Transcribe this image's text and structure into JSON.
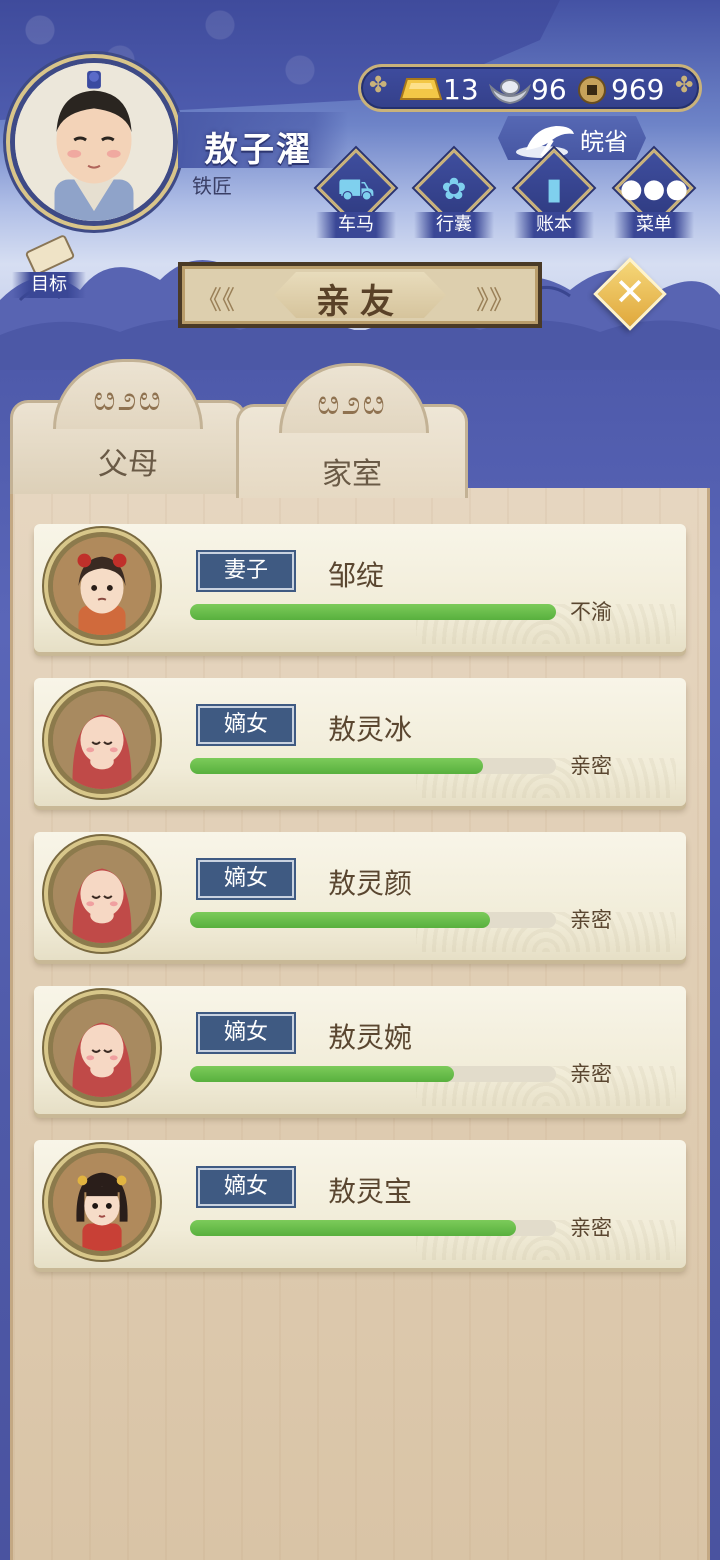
{
  "player": {
    "name": "敖子濯",
    "occupation": "铁匠"
  },
  "currency": {
    "gold": "13",
    "silver": "96",
    "coins": "969"
  },
  "region": {
    "label": "皖省"
  },
  "nav": [
    {
      "label": "车马",
      "icon": "carriage-icon"
    },
    {
      "label": "行囊",
      "icon": "bundle-icon"
    },
    {
      "label": "账本",
      "icon": "ledger-icon"
    },
    {
      "label": "菜单",
      "icon": "menu-dots-icon"
    }
  ],
  "goal": {
    "label": "目标"
  },
  "panel": {
    "title": "亲友"
  },
  "tabs": [
    {
      "label": "父母",
      "active": false
    },
    {
      "label": "家室",
      "active": true
    }
  ],
  "members": [
    {
      "role": "妻子",
      "name": "邹绽",
      "bond": "不渝",
      "bond_level": 1.0,
      "portrait": "adult-woman"
    },
    {
      "role": "嫡女",
      "name": "敖灵冰",
      "bond": "亲密",
      "bond_level": 0.8,
      "portrait": "baby"
    },
    {
      "role": "嫡女",
      "name": "敖灵颜",
      "bond": "亲密",
      "bond_level": 0.82,
      "portrait": "baby"
    },
    {
      "role": "嫡女",
      "name": "敖灵婉",
      "bond": "亲密",
      "bond_level": 0.72,
      "portrait": "baby"
    },
    {
      "role": "嫡女",
      "name": "敖灵宝",
      "bond": "亲密",
      "bond_level": 0.89,
      "portrait": "girl"
    }
  ],
  "colors": {
    "accent_gold": "#c9b27a",
    "bar_green": "#6cc04c",
    "badge_blue": "#3f5a82",
    "sky_blue": "#4a56a6"
  }
}
